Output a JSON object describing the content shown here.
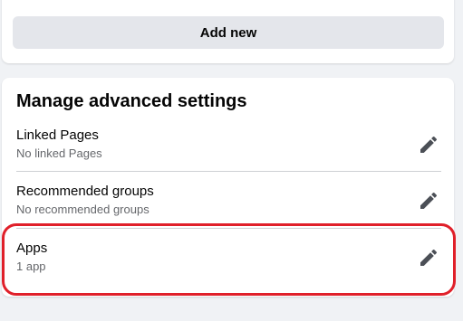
{
  "top_card": {
    "add_new_label": "Add new"
  },
  "advanced": {
    "title": "Manage advanced settings",
    "rows": [
      {
        "title": "Linked Pages",
        "subtitle": "No linked Pages",
        "icon": "pencil-icon"
      },
      {
        "title": "Recommended groups",
        "subtitle": "No recommended groups",
        "icon": "pencil-icon"
      },
      {
        "title": "Apps",
        "subtitle": "1 app",
        "icon": "pencil-icon"
      }
    ]
  },
  "colors": {
    "background": "#f0f2f5",
    "card": "#ffffff",
    "button": "#e4e6eb",
    "secondary_text": "#65676b",
    "highlight": "#e0202a"
  }
}
